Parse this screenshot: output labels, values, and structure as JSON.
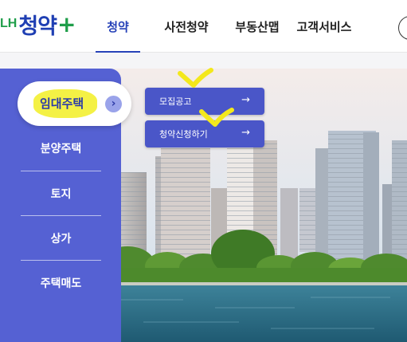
{
  "logo": {
    "prefix": "LH",
    "name": "청약",
    "plus": "+"
  },
  "nav": {
    "items": [
      {
        "label": "청약",
        "active": true
      },
      {
        "label": "사전청약",
        "active": false
      },
      {
        "label": "부동산맵",
        "active": false
      },
      {
        "label": "고객서비스",
        "active": false
      }
    ]
  },
  "sidebar": {
    "active_label": "임대주택",
    "items": [
      {
        "label": "분양주택"
      },
      {
        "label": "토지"
      },
      {
        "label": "상가"
      },
      {
        "label": "주택매도"
      }
    ]
  },
  "submenu": {
    "items": [
      {
        "label": "모집공고",
        "arrow": "→"
      },
      {
        "label": "청약신청하기",
        "arrow": "→"
      }
    ]
  },
  "icons": {
    "active_arrow": "chevron-right-icon",
    "submenu_arrow": "arrow-right-icon"
  },
  "colors": {
    "brand_blue": "#2742b8",
    "sidebar": "#5561d3",
    "submenu": "#4a56c8",
    "highlight": "#f3f03b",
    "logo_green": "#1f9e4a"
  }
}
